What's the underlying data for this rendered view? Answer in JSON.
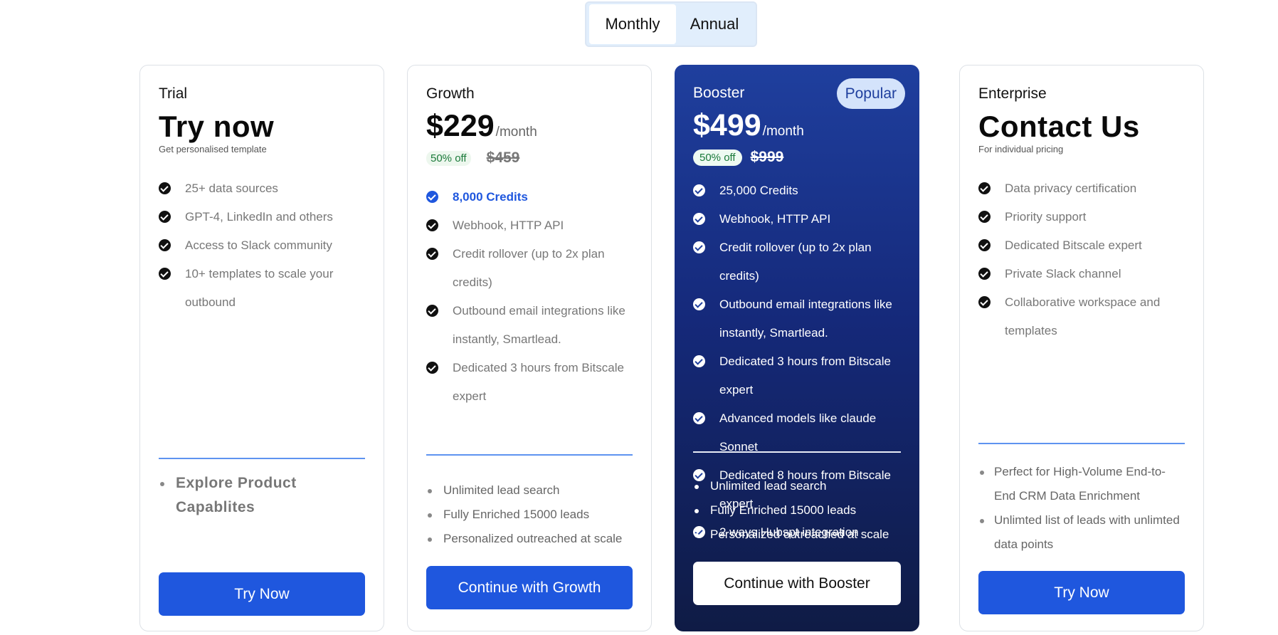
{
  "billing_toggle": {
    "monthly": "Monthly",
    "annual": "Annual"
  },
  "plans": {
    "trial": {
      "name": "Trial",
      "headline": "Try now",
      "subtitle": "Get personalised template",
      "features": [
        "25+ data sources",
        "GPT-4, LinkedIn and others",
        "Access to Slack community",
        "10+ templates to scale your outbound"
      ],
      "extras": [
        "Explore Product Capablites"
      ],
      "cta": "Try Now"
    },
    "growth": {
      "name": "Growth",
      "price": "$229",
      "period": "/month",
      "discount": "50% off",
      "original_price": "$459",
      "features": [
        "8,000 Credits",
        "Webhook, HTTP API",
        "Credit rollover (up to 2x plan credits)",
        "Outbound email integrations like instantly, Smartlead.",
        "Dedicated 3 hours from Bitscale expert"
      ],
      "extras": [
        "Unlimited lead search",
        "Fully Enriched 15000 leads",
        "Personalized outreached at scale"
      ],
      "cta": "Continue with Growth"
    },
    "booster": {
      "name": "Booster",
      "badge": "Popular",
      "price": "$499",
      "period": "/month",
      "discount": "50% off",
      "original_price": "$999",
      "features": [
        "25,000 Credits",
        "Webhook, HTTP API",
        "Credit rollover (up to 2x plan credits)",
        "Outbound email integrations like instantly, Smartlead.",
        "Dedicated 3 hours from Bitscale expert",
        "Advanced models like claude Sonnet",
        "Dedicated 8 hours from Bitscale expert",
        "2 ways Hubspt integration"
      ],
      "extras": [
        "Unlimited lead search",
        "Fully Enriched 15000 leads",
        "Personalized outreached at scale"
      ],
      "cta": "Continue with Booster"
    },
    "enterprise": {
      "name": "Enterprise",
      "headline": "Contact Us",
      "subtitle": "For individual pricing",
      "features": [
        "Data privacy certification",
        "Priority support",
        "Dedicated Bitscale expert",
        "Private Slack channel",
        "Collaborative workspace and templates"
      ],
      "extras": [
        "Perfect for High-Volume End-to-End CRM Data Enrichment",
        "Unlimted list of leads with unlimted data points"
      ],
      "cta": "Try Now"
    }
  },
  "colors": {
    "primary": "#1f57de",
    "booster_top": "#1f3f9e",
    "booster_bottom": "#0f1b45"
  }
}
